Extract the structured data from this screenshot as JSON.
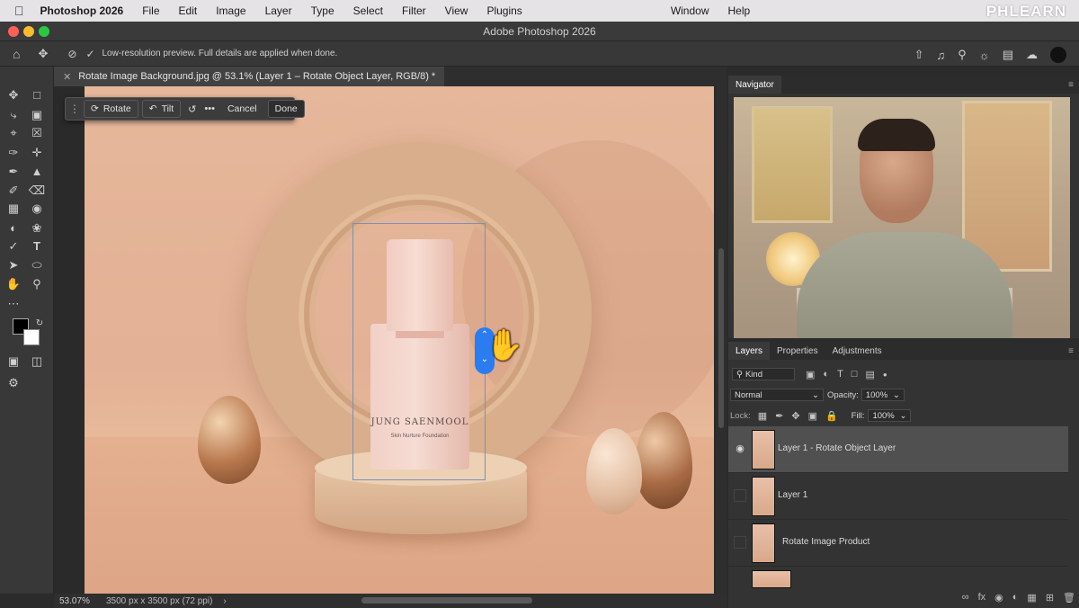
{
  "menubar": {
    "apple": "",
    "app_name": "Photoshop 2026",
    "items": [
      "File",
      "Edit",
      "Image",
      "Layer",
      "Type",
      "Select",
      "Filter",
      "View",
      "Plugins"
    ],
    "right_items": [
      "Window",
      "Help"
    ],
    "watermark": "PHLEARN"
  },
  "window": {
    "title": "Adobe Photoshop 2026"
  },
  "options": {
    "preview_text": "Low-resolution preview. Full details are applied when done."
  },
  "document": {
    "tab_title": "Rotate Image Background.jpg @ 53.1% (Layer 1 – Rotate Object Layer, RGB/8) *"
  },
  "context_bar": {
    "rotate": "Rotate",
    "tilt": "Tilt",
    "more": "•••",
    "cancel": "Cancel",
    "done": "Done"
  },
  "product": {
    "brand": "JUNG SAENMOOL",
    "subtext": "Skin Nurture Foundation"
  },
  "status": {
    "zoom": "53.07%",
    "doc_info": "3500 px x 3500 px (72 ppi)",
    "arrow": "›"
  },
  "navigator": {
    "tab": "Navigator"
  },
  "layers_panel": {
    "tabs": [
      "Layers",
      "Properties",
      "Adjustments"
    ],
    "kind_placeholder": "Kind",
    "blend_mode": "Normal",
    "opacity_label": "Opacity:",
    "opacity_value": "100%",
    "lock_label": "Lock:",
    "fill_label": "Fill:",
    "fill_value": "100%",
    "layers": [
      {
        "name": "Layer 1 - Rotate Object Layer",
        "visible": true,
        "selected": true
      },
      {
        "name": "Layer 1",
        "visible": false,
        "selected": false
      },
      {
        "name": "Rotate Image Product",
        "visible": false,
        "selected": false
      }
    ]
  },
  "colors": {
    "accent": "#2b7cf0",
    "panel_bg": "#333333",
    "canvas_bg": "#e6b79a"
  }
}
